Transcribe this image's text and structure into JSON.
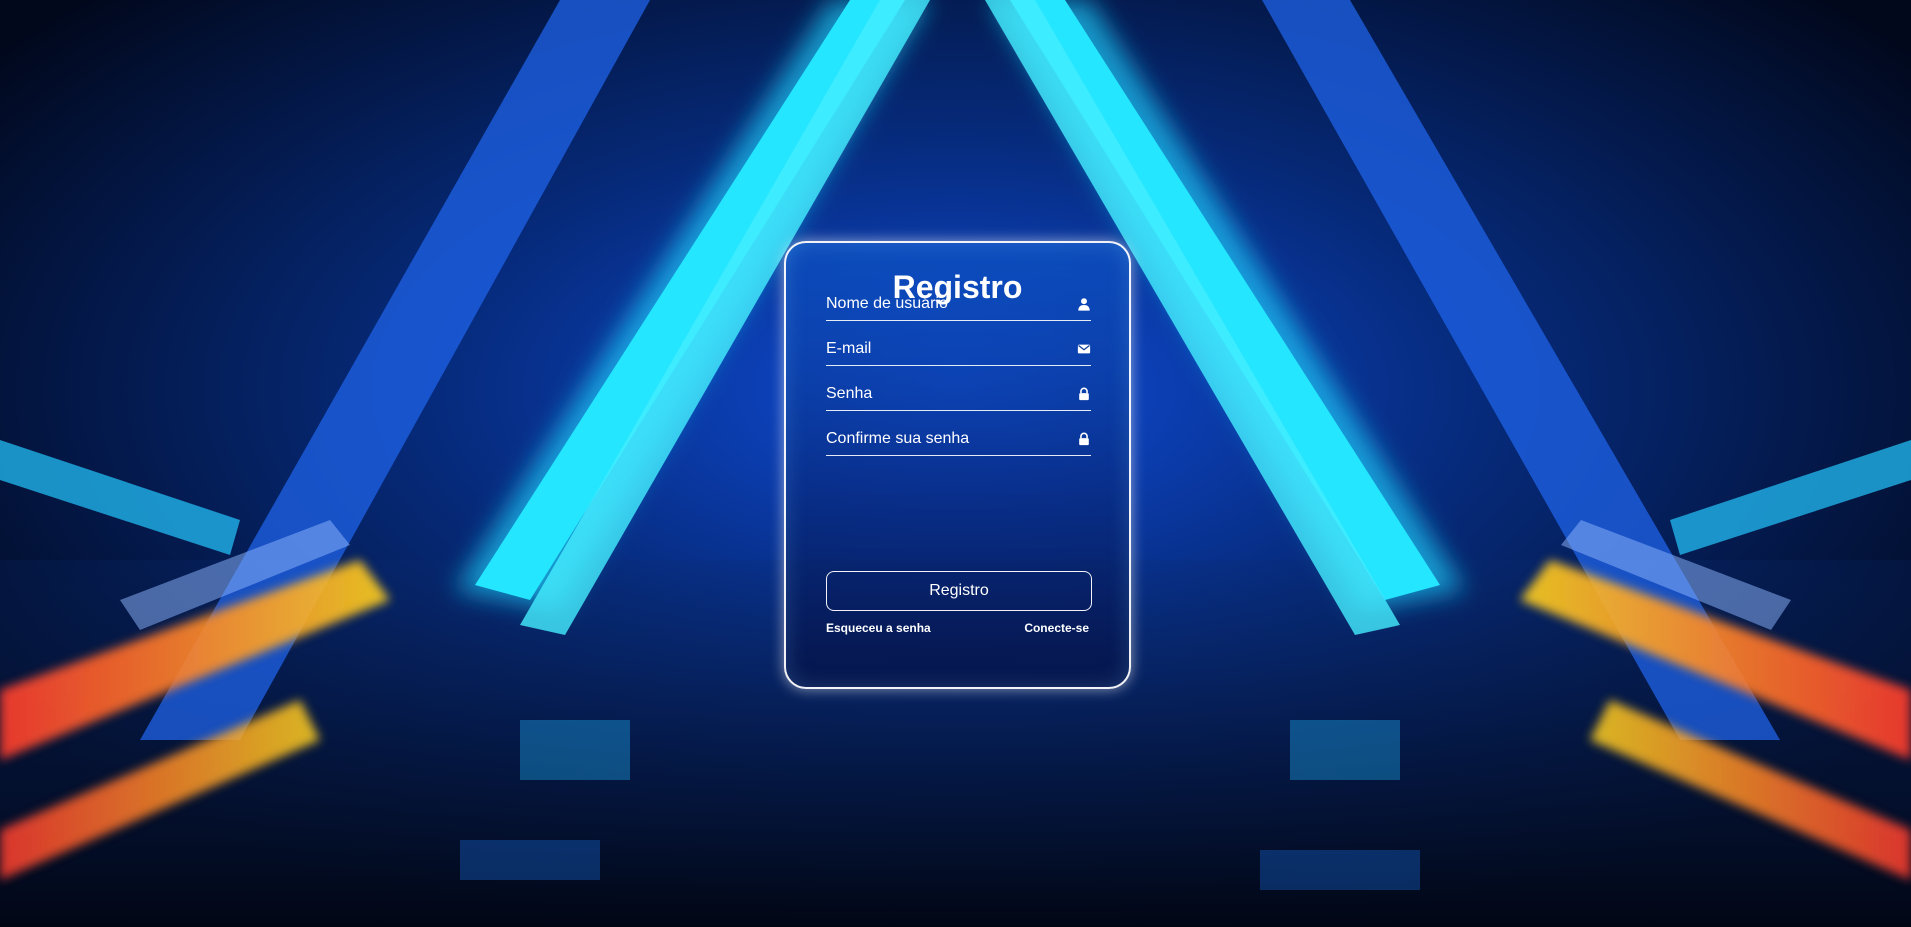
{
  "form": {
    "title": "Registro",
    "fields": [
      {
        "placeholder": "Nome de usuário",
        "value": "",
        "icon": "user-icon"
      },
      {
        "placeholder": "E-mail",
        "value": "",
        "icon": "envelope-icon"
      },
      {
        "placeholder": "Senha",
        "value": "",
        "icon": "lock-icon"
      },
      {
        "placeholder": "Confirme sua senha",
        "value": "",
        "icon": "lock-icon"
      }
    ],
    "submit_label": "Registro",
    "forgot_label": "Esqueceu a senha",
    "login_label": "Conecte-se"
  },
  "colors": {
    "accent_cyan": "#19d4ff",
    "accent_blue": "#1565ff",
    "card_border": "#ffffff",
    "text": "#ffffff"
  }
}
